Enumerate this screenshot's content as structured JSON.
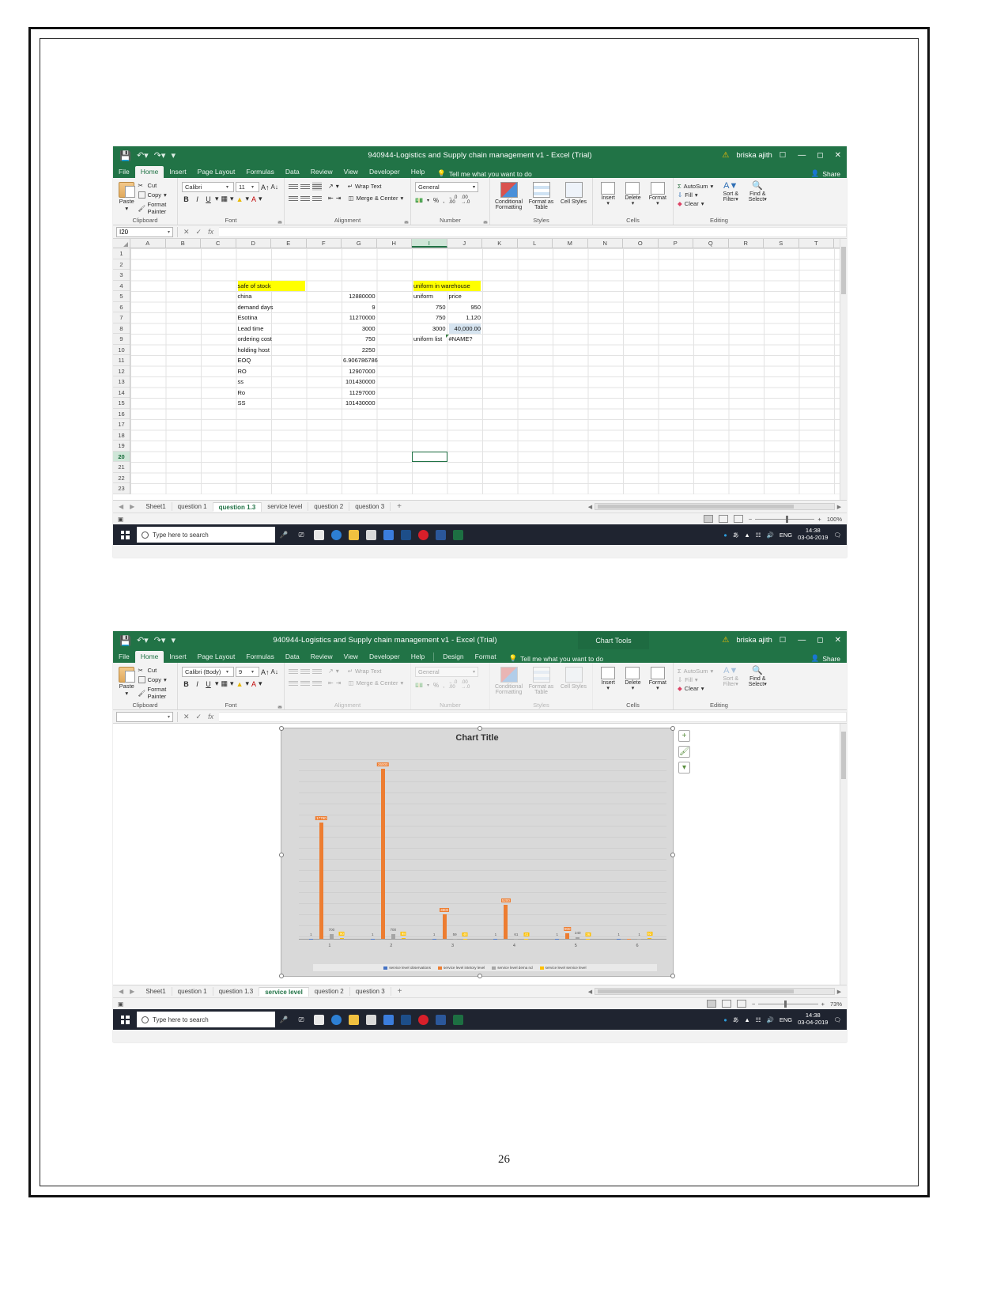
{
  "page": {
    "number": "26"
  },
  "window1": {
    "title": "940944-Logistics and Supply chain management v1  -  Excel (Trial)",
    "user": "briska ajith",
    "qat": {
      "save": "save-icon",
      "undo": "undo-icon",
      "redo": "redo-icon",
      "more": "customize-icon"
    },
    "ribbon_tabs": [
      "File",
      "Home",
      "Insert",
      "Page Layout",
      "Formulas",
      "Data",
      "Review",
      "View",
      "Developer",
      "Help"
    ],
    "active_tab": "Home",
    "tell_me": "Tell me what you want to do",
    "share": "Share",
    "groups": {
      "clipboard": {
        "label": "Clipboard",
        "paste": "Paste",
        "cut": "Cut",
        "copy": "Copy",
        "format_painter": "Format Painter"
      },
      "font": {
        "label": "Font",
        "font_name": "Calibri",
        "font_size": "11",
        "grow": "A",
        "shrink": "A",
        "bold": "B",
        "italic": "I",
        "underline": "U"
      },
      "alignment": {
        "label": "Alignment",
        "wrap": "Wrap Text",
        "merge": "Merge & Center"
      },
      "number": {
        "label": "Number",
        "format": "General",
        "percent": "%",
        "comma": ","
      },
      "styles": {
        "label": "Styles",
        "conditional": "Conditional Formatting",
        "table": "Format as Table",
        "cell_styles": "Cell Styles"
      },
      "cells": {
        "label": "Cells",
        "insert": "Insert",
        "delete": "Delete",
        "format": "Format"
      },
      "editing": {
        "label": "Editing",
        "autosum": "AutoSum",
        "fill": "Fill",
        "clear": "Clear",
        "sort_filter": "Sort & Filter",
        "find_select": "Find & Select"
      }
    },
    "name_box": "I20",
    "formula": "",
    "columns": [
      "A",
      "B",
      "C",
      "D",
      "E",
      "F",
      "G",
      "H",
      "I",
      "J",
      "K",
      "L",
      "M",
      "N",
      "O",
      "P",
      "Q",
      "R",
      "S",
      "T"
    ],
    "selected_column": "I",
    "rows": [
      "1",
      "2",
      "3",
      "4",
      "5",
      "6",
      "7",
      "8",
      "9",
      "10",
      "11",
      "12",
      "13",
      "14",
      "15",
      "16",
      "17",
      "18",
      "19",
      "20",
      "21",
      "22",
      "23"
    ],
    "selected_row": "20",
    "cells": [
      {
        "row": 4,
        "col": "D",
        "text": "safe of stock",
        "style": "highlight"
      },
      {
        "row": 5,
        "col": "D",
        "text": "china"
      },
      {
        "row": 5,
        "col": "G",
        "text": "12880000",
        "align": "right"
      },
      {
        "row": 6,
        "col": "D",
        "text": "demand days"
      },
      {
        "row": 6,
        "col": "G",
        "text": "9",
        "align": "right"
      },
      {
        "row": 7,
        "col": "D",
        "text": "Esotina"
      },
      {
        "row": 7,
        "col": "G",
        "text": "11270000",
        "align": "right"
      },
      {
        "row": 8,
        "col": "D",
        "text": "Lead time"
      },
      {
        "row": 8,
        "col": "G",
        "text": "3000",
        "align": "right"
      },
      {
        "row": 9,
        "col": "D",
        "text": "ordering cost"
      },
      {
        "row": 9,
        "col": "G",
        "text": "750",
        "align": "right"
      },
      {
        "row": 10,
        "col": "D",
        "text": "holding host"
      },
      {
        "row": 10,
        "col": "G",
        "text": "2250",
        "align": "right"
      },
      {
        "row": 11,
        "col": "D",
        "text": "EOQ"
      },
      {
        "row": 11,
        "col": "G",
        "text": "6.906786786",
        "align": "right"
      },
      {
        "row": 12,
        "col": "D",
        "text": "RO"
      },
      {
        "row": 12,
        "col": "G",
        "text": "12907000",
        "align": "right"
      },
      {
        "row": 13,
        "col": "D",
        "text": "ss"
      },
      {
        "row": 13,
        "col": "G",
        "text": "101430000",
        "align": "right"
      },
      {
        "row": 14,
        "col": "D",
        "text": "Ro"
      },
      {
        "row": 14,
        "col": "G",
        "text": "11297000",
        "align": "right"
      },
      {
        "row": 15,
        "col": "D",
        "text": "SS"
      },
      {
        "row": 15,
        "col": "G",
        "text": "101430000",
        "align": "right"
      },
      {
        "row": 4,
        "col": "I",
        "text": "uniform in warehouse",
        "style": "highlight"
      },
      {
        "row": 5,
        "col": "I",
        "text": "uniform"
      },
      {
        "row": 5,
        "col": "J",
        "text": "price"
      },
      {
        "row": 6,
        "col": "I",
        "text": "750",
        "align": "right"
      },
      {
        "row": 6,
        "col": "J",
        "text": "950",
        "align": "right"
      },
      {
        "row": 7,
        "col": "I",
        "text": "750",
        "align": "right"
      },
      {
        "row": 7,
        "col": "J",
        "text": "1,120",
        "align": "right"
      },
      {
        "row": 8,
        "col": "I",
        "text": "3000",
        "align": "right"
      },
      {
        "row": 8,
        "col": "J",
        "text": "40,000.00",
        "align": "right",
        "style": "bluecell"
      },
      {
        "row": 9,
        "col": "I",
        "text": "uniform list"
      },
      {
        "row": 9,
        "col": "J",
        "text": "#NAME?",
        "style": "error"
      }
    ],
    "sheet_tabs": [
      "Sheet1",
      "question 1",
      "question 1.3",
      "service level",
      "question 2",
      "question 3"
    ],
    "active_sheet": "question 1.3",
    "add_sheet": "+",
    "zoom": "100%",
    "taskbar": {
      "search_placeholder": "Type here to search",
      "language": "ENG",
      "time": "14:38",
      "date": "03-04-2019"
    }
  },
  "window2": {
    "title": "940944-Logistics and Supply chain management v1  -  Excel (Trial)",
    "context_tab_title": "Chart Tools",
    "user": "briska ajith",
    "ribbon_tabs": [
      "File",
      "Home",
      "Insert",
      "Page Layout",
      "Formulas",
      "Data",
      "Review",
      "View",
      "Developer",
      "Help"
    ],
    "context_tabs": [
      "Design",
      "Format"
    ],
    "active_tab": "Home",
    "tell_me": "Tell me what you want to do",
    "share": "Share",
    "groups": {
      "clipboard": {
        "label": "Clipboard",
        "paste": "Paste",
        "cut": "Cut",
        "copy": "Copy",
        "format_painter": "Format Painter"
      },
      "font": {
        "label": "Font",
        "font_name": "Calibri (Body)",
        "font_size": "9",
        "bold": "B",
        "italic": "I",
        "underline": "U"
      },
      "alignment": {
        "label": "Alignment",
        "wrap": "Wrap Text",
        "merge": "Merge & Center"
      },
      "number": {
        "label": "Number",
        "format": "General",
        "percent": "%",
        "comma": ","
      },
      "styles": {
        "label": "Styles",
        "conditional": "Conditional Formatting",
        "table": "Format as Table",
        "cell_styles": "Cell Styles"
      },
      "cells": {
        "label": "Cells",
        "insert": "Insert",
        "delete": "Delete",
        "format": "Format"
      },
      "editing": {
        "label": "Editing",
        "autosum": "AutoSum",
        "fill": "Fill",
        "clear": "Clear",
        "sort_filter": "Sort & Filter",
        "find_select": "Find & Select"
      }
    },
    "name_box": "",
    "formula": "",
    "sheet_tabs": [
      "Sheet1",
      "question 1",
      "question 1.3",
      "service level",
      "question 2",
      "question 3"
    ],
    "active_sheet": "service level",
    "add_sheet": "+",
    "zoom": "73%",
    "chart_buttons": [
      "chart-elements-icon",
      "chart-styles-icon",
      "chart-filters-icon"
    ],
    "taskbar": {
      "search_placeholder": "Type here to search",
      "language": "ENG",
      "time": "14:38",
      "date": "03-04-2019"
    }
  },
  "chart_data": {
    "type": "bar",
    "title": "Chart Title",
    "xlabel": "",
    "ylabel": "",
    "categories": [
      "1",
      "2",
      "3",
      "4",
      "5",
      "6"
    ],
    "legend_position": "bottom",
    "grid": true,
    "series": [
      {
        "name": "service level observations",
        "color": "#4472c4",
        "values": [
          1,
          1,
          1,
          1,
          1,
          1
        ],
        "labels": [
          "1",
          "1",
          "1",
          "1",
          "1",
          "1"
        ]
      },
      {
        "name": "service level intetory level",
        "color": "#ed7d31",
        "values": [
          17790,
          26000,
          3800,
          5200,
          900,
          0
        ],
        "labels": [
          "17790",
          "26000",
          "3800",
          "5200",
          "900",
          ""
        ]
      },
      {
        "name": "service level dema nd",
        "color": "#a5a5a5",
        "values": [
          700,
          700,
          59,
          61,
          240,
          1
        ],
        "labels": [
          "700",
          "700",
          "59",
          "61",
          "240",
          "1"
        ]
      },
      {
        "name": "service level service level",
        "color": "#ffc000",
        "values": [
          90,
          98,
          48,
          41,
          36,
          92
        ],
        "labels": [
          "90",
          "98",
          "48",
          "41",
          "36",
          "92"
        ]
      }
    ]
  }
}
